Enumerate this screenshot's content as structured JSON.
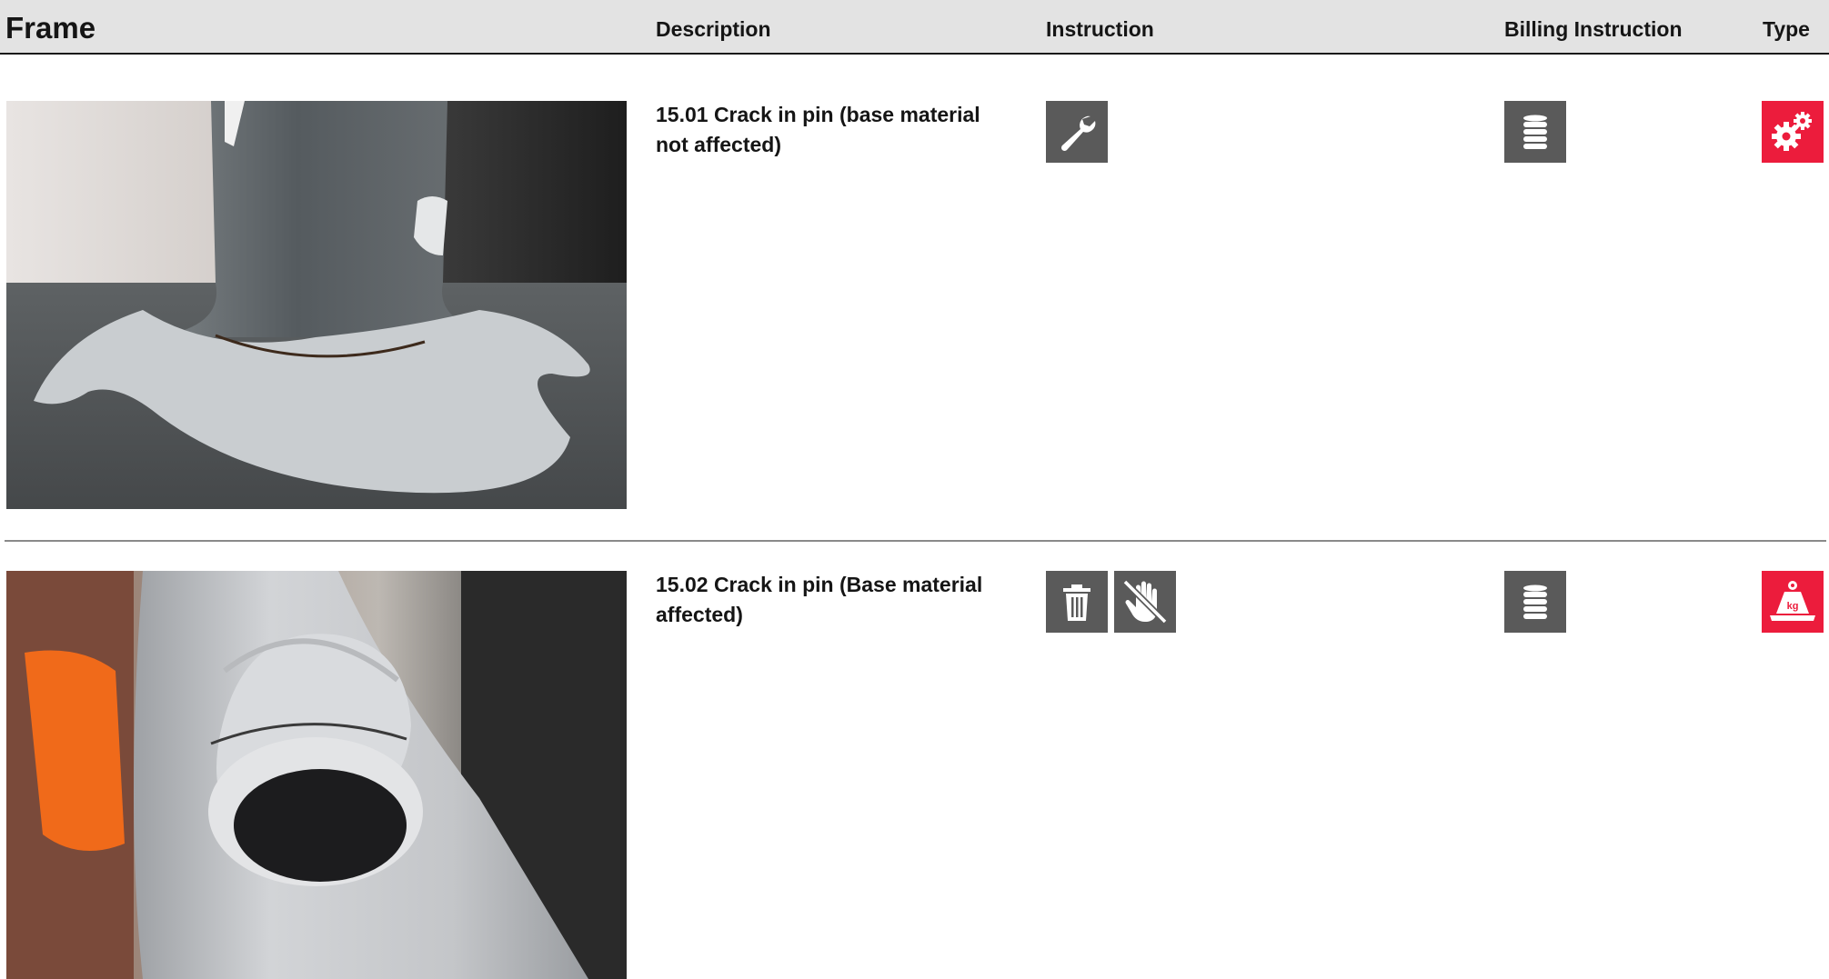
{
  "header": {
    "frame": "Frame",
    "description": "Description",
    "instruction": "Instruction",
    "billing_instruction": "Billing Instruction",
    "type": "Type"
  },
  "rows": [
    {
      "description": "15.01 Crack in pin (base material not affected)",
      "instruction_icons": [
        "wrench-icon"
      ],
      "billing_icon": "coin-stack-icon",
      "type_icon": "gears-icon"
    },
    {
      "description": "15.02 Crack in pin (Base material affected)",
      "instruction_icons": [
        "trash-icon",
        "no-touch-hand-icon"
      ],
      "billing_icon": "coin-stack-icon",
      "type_icon": "weight-kg-icon",
      "type_icon_text": "kg"
    }
  ],
  "colors": {
    "header_bg": "#e3e3e3",
    "icon_gray": "#5a5a5a",
    "type_red": "#ec1c3c"
  }
}
